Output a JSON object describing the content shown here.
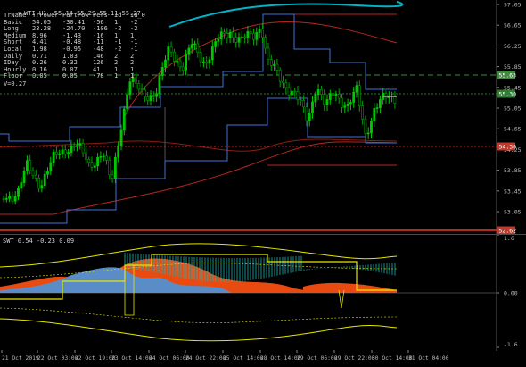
{
  "main": {
    "header": "WTI,H1  55.14 55.29 55.11 55.27",
    "table": {
      "headers": [
        "TrName",
        "TrPower",
        "PartPow",
        "Pers",
        "Id",
        "Id_0"
      ],
      "rows": [
        [
          "Basic",
          "54.05",
          "-30.41",
          "-56",
          "1",
          "-2"
        ],
        [
          "Long",
          "23.28",
          "-24.70",
          "-106",
          "-2",
          "-2"
        ],
        [
          "Medium",
          "8.96",
          "-1.43",
          "-16",
          "1",
          "1"
        ],
        [
          "Short",
          "4.41",
          "-0.48",
          "-11",
          "-1",
          "-1"
        ],
        [
          "Local",
          "1.98",
          "-0.95",
          "-48",
          "-2",
          "-1"
        ],
        [
          "Daily",
          "0.71",
          "1.03",
          "146",
          "2",
          "2"
        ],
        [
          "IDay",
          "0.26",
          "0.32",
          "126",
          "2",
          "2"
        ],
        [
          "Hourly",
          "0.16",
          "0.07",
          "41",
          "1",
          "1"
        ],
        [
          "Floor",
          "0.05",
          "0.05",
          "-78",
          "1",
          "1"
        ]
      ],
      "footer": "V=0.27"
    },
    "price_axis": [
      "57.05",
      "56.65",
      "56.25",
      "55.85",
      "55.45",
      "55.05",
      "54.65",
      "54.25",
      "53.85",
      "53.45",
      "53.05"
    ],
    "price_tags": [
      {
        "text": "55.63",
        "color": "#3c8c3c"
      },
      {
        "text": "55.30",
        "color": "#2e7d32"
      },
      {
        "text": "54.30",
        "color": "#c0392b"
      },
      {
        "text": "52.62",
        "color": "#c0392b"
      }
    ]
  },
  "sub": {
    "header": "SWT 0.54 -0.23 0.09",
    "axis": [
      "1.6",
      "0.00",
      "-1.6"
    ]
  },
  "time_axis": [
    "21 Oct 2019",
    "22 Oct 03:00",
    "22 Oct 19:00",
    "23 Oct 14:00",
    "24 Oct 06:00",
    "24 Oct 22:00",
    "25 Oct 14:00",
    "28 Oct 14:00",
    "29 Oct 06:00",
    "29 Oct 22:00",
    "30 Oct 14:00",
    "31 Oct 04:00"
  ],
  "colors": {
    "bull": "#00c800",
    "blue_line": "#3f6fd8",
    "red_line": "#b4281e",
    "cyan": "#00b4c8",
    "yellow": "#e6e600",
    "orange_fill": "#e84a10",
    "steel_fill": "#5a8cc8",
    "teal_hatch": "#20b4b4"
  }
}
